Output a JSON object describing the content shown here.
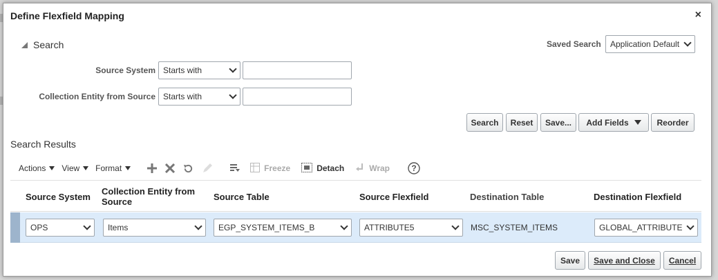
{
  "dialog": {
    "title": "Define Flexfield Mapping",
    "close_label": "×"
  },
  "search": {
    "header": "Search",
    "saved_search_label": "Saved Search",
    "saved_search_value": "Application Default",
    "fields": [
      {
        "label": "Source System",
        "operator": "Starts with",
        "value": ""
      },
      {
        "label": "Collection Entity from Source",
        "operator": "Starts with",
        "value": ""
      }
    ],
    "buttons": {
      "search": "Search",
      "reset": "Reset",
      "save": "Save...",
      "add_fields": "Add Fields",
      "reorder": "Reorder"
    }
  },
  "results": {
    "header": "Search Results",
    "toolbar": {
      "actions": "Actions",
      "view": "View",
      "format": "Format",
      "freeze": "Freeze",
      "detach": "Detach",
      "wrap": "Wrap"
    },
    "columns": [
      "Source System",
      "Collection Entity from Source",
      "Source Table",
      "Source Flexfield",
      "Destination Table",
      "Destination Flexfield"
    ],
    "rows": [
      {
        "source_system": "OPS",
        "collection_entity": "Items",
        "source_table": "EGP_SYSTEM_ITEMS_B",
        "source_flexfield": "ATTRIBUTE5",
        "destination_table": "MSC_SYSTEM_ITEMS",
        "destination_flexfield": "GLOBAL_ATTRIBUTE"
      }
    ]
  },
  "footer": {
    "save": "Save",
    "save_and_close": "Save and Close",
    "cancel": "Cancel"
  }
}
